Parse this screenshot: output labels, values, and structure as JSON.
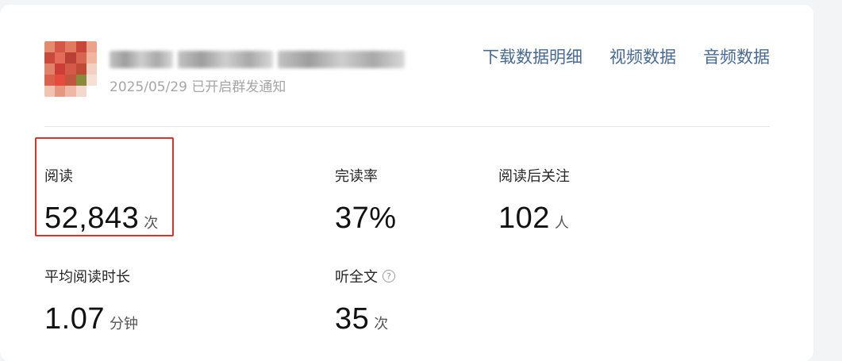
{
  "header": {
    "date": "2025/05/29",
    "status": "已开启群发通知",
    "links": [
      {
        "label": "下载数据明细"
      },
      {
        "label": "视频数据"
      },
      {
        "label": "音频数据"
      }
    ]
  },
  "stats": {
    "reads": {
      "label": "阅读",
      "value": "52,843",
      "unit": "次"
    },
    "completion_rate": {
      "label": "完读率",
      "value": "37%",
      "unit": ""
    },
    "follows_after_read": {
      "label": "阅读后关注",
      "value": "102",
      "unit": "人"
    },
    "avg_read_time": {
      "label": "平均阅读时长",
      "value": "1.07",
      "unit": "分钟"
    },
    "listen_full": {
      "label": "听全文",
      "value": "35",
      "unit": "次",
      "help_icon": "question-circle-icon"
    }
  },
  "colors": {
    "link": "#4a6a91",
    "highlight": "#e0302a"
  }
}
